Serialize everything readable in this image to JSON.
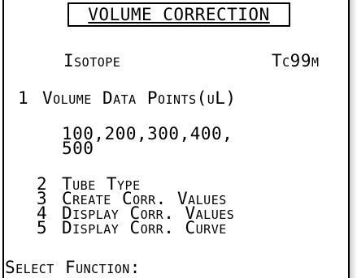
{
  "title": "VOLUME CORRECTION",
  "isotope": {
    "label": "Isotope",
    "value": "Tc99m"
  },
  "volume_points": {
    "number": "1",
    "label": "Volume Data Points(uL)",
    "values_line1": "100,200,300,400,",
    "values_line2": "500"
  },
  "menu": [
    {
      "number": "2",
      "label": "Tube Type"
    },
    {
      "number": "3",
      "label": "Create Corr. Values"
    },
    {
      "number": "4",
      "label": "Display Corr. Values"
    },
    {
      "number": "5",
      "label": "Display Corr. Curve"
    }
  ],
  "prompt": "Select Function:"
}
